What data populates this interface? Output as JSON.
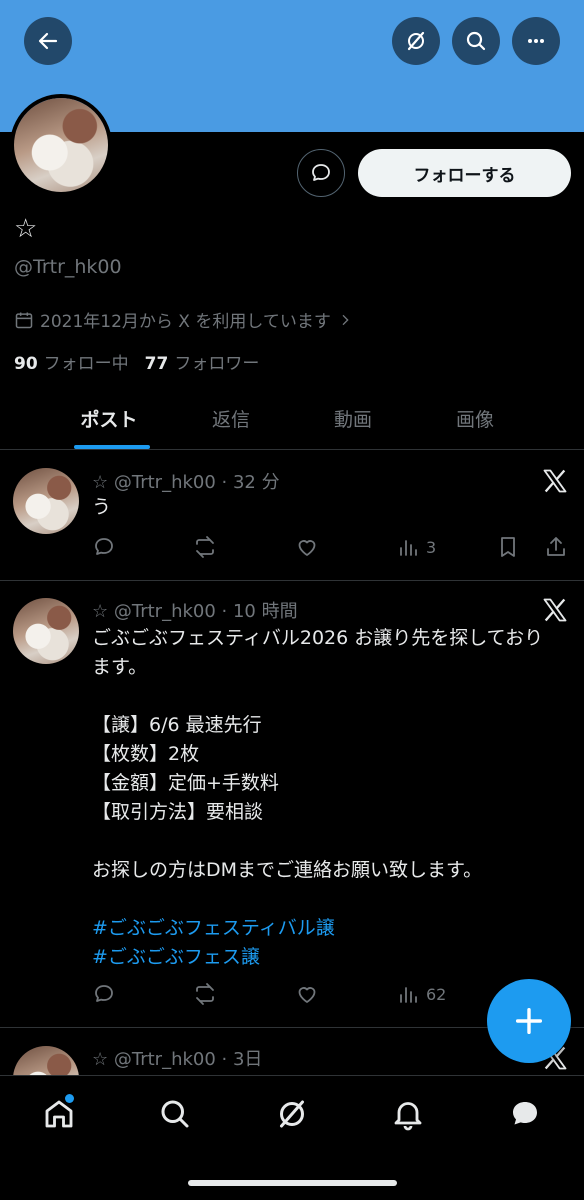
{
  "header": {
    "back_icon": "arrow-left-icon",
    "grok_icon": "grok-icon",
    "search_icon": "search-icon",
    "more_icon": "more-dots-icon",
    "banner_color": "#4a9be3"
  },
  "profile": {
    "name": "☆",
    "handle": "@Trtr_hk00",
    "joined": "2021年12月から X を利用しています",
    "following_count": "90",
    "following_label": "フォロー中",
    "followers_count": "77",
    "followers_label": "フォロワー",
    "follow_button": "フォローする"
  },
  "tabs": [
    {
      "label": "ポスト",
      "active": true
    },
    {
      "label": "返信",
      "active": false
    },
    {
      "label": "動画",
      "active": false
    },
    {
      "label": "画像",
      "active": false
    }
  ],
  "posts": [
    {
      "meta": "☆ @Trtr_hk00 · 32 分",
      "body": [
        "う"
      ],
      "views": "3"
    },
    {
      "meta": "☆ @Trtr_hk00 · 10 時間",
      "body": [
        "ごぶごぶフェスティバル2026 お譲り先を探しております。",
        "",
        "【譲】6/6 最速先行",
        "【枚数】2枚",
        "【金額】定価+手数料",
        "【取引方法】要相談",
        "",
        "お探しの方はDMまでご連絡お願い致します。",
        ""
      ],
      "hashtags": [
        "#ごぶごぶフェスティバル譲",
        "#ごぶごぶフェス譲"
      ],
      "views": "62"
    },
    {
      "meta": "☆ @Trtr_hk00 · 3日"
    }
  ],
  "colors": {
    "accent": "#1d9bf0",
    "background": "#000000",
    "text": "#e7e9ea",
    "muted": "#71767b"
  }
}
